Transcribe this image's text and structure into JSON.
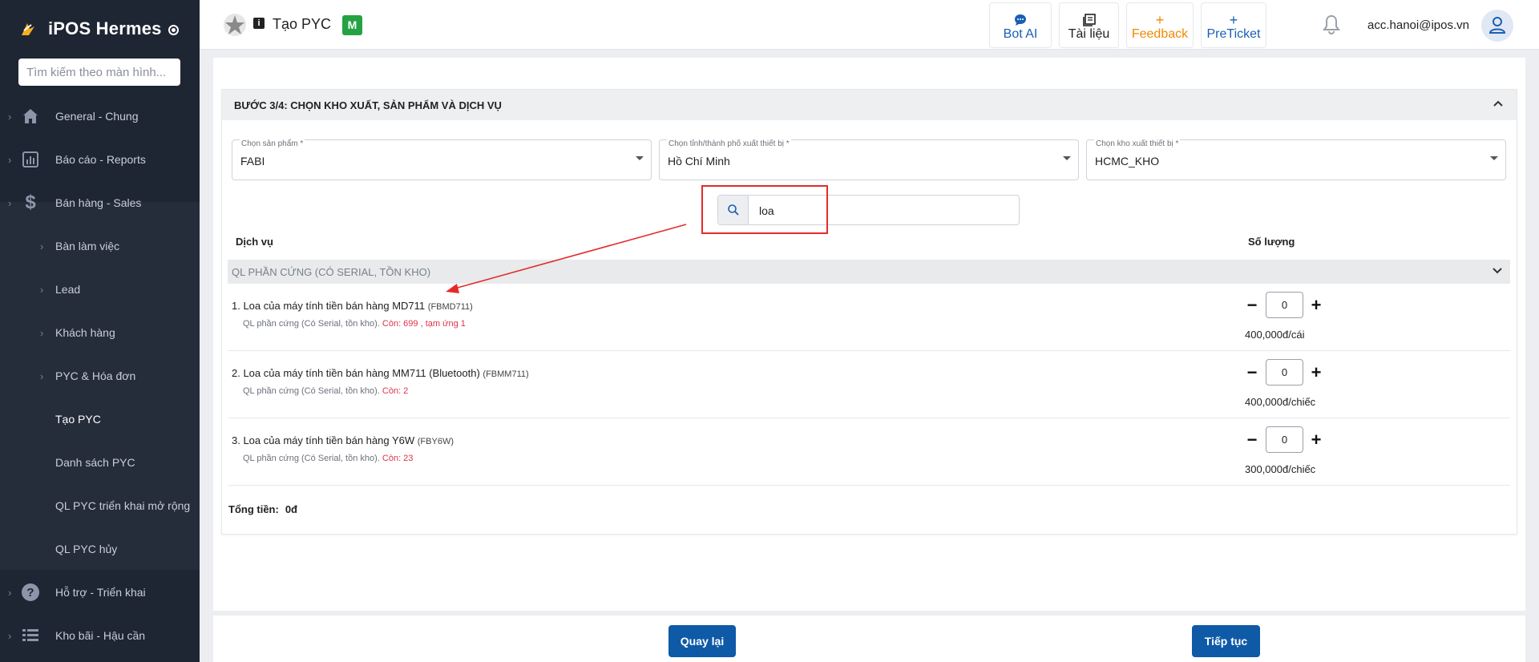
{
  "app": {
    "name": "iPOS Hermes",
    "search_placeholder": "Tìm kiếm theo màn hình..."
  },
  "sidebar": {
    "items": [
      {
        "label": "General - Chung",
        "icon": "home-icon"
      },
      {
        "label": "Báo cáo - Reports",
        "icon": "bar-chart-icon"
      },
      {
        "label": "Bán hàng - Sales",
        "icon": "dollar-icon"
      },
      {
        "label": "Bàn làm việc"
      },
      {
        "label": "Lead"
      },
      {
        "label": "Khách hàng"
      },
      {
        "label": "PYC & Hóa đơn"
      },
      {
        "label": "Tạo PYC"
      },
      {
        "label": "Danh sách PYC"
      },
      {
        "label": "QL PYC triển khai mở rộng"
      },
      {
        "label": "QL PYC hủy"
      },
      {
        "label": "Hỗ trợ - Triển khai",
        "icon": "help-circle-icon"
      },
      {
        "label": "Kho bãi - Hậu cần",
        "icon": "list-icon"
      }
    ]
  },
  "header": {
    "title": "Tạo PYC",
    "badge": "M",
    "buttons": [
      {
        "label": "Bot AI",
        "icon": "chat-icon",
        "color": "#1a5fb4"
      },
      {
        "label": "Tài liệu",
        "icon": "book-icon",
        "color": "#222222"
      },
      {
        "label": "Feedback",
        "icon": "plus-icon",
        "color": "#f08a00"
      },
      {
        "label": "PreTicket",
        "icon": "plus-icon",
        "color": "#1a5fb4"
      }
    ],
    "user_email": "acc.hanoi@ipos.vn"
  },
  "step": {
    "title": "BƯỚC 3/4: CHỌN KHO XUẤT, SẢN PHẨM VÀ DỊCH VỤ",
    "product": {
      "label": "Chọn sản phẩm *",
      "value": "FABI"
    },
    "province": {
      "label": "Chọn tỉnh/thành phố xuất thiết bị *",
      "value": "Hồ Chí Minh"
    },
    "warehouse": {
      "label": "Chọn kho xuất thiết bị *",
      "value": "HCMC_KHO"
    },
    "search_value": "loa",
    "col_service": "Dịch vụ",
    "col_qty": "Số lượng",
    "group": "QL PHẦN CỨNG (CÓ SERIAL, TỒN KHO)",
    "items": [
      {
        "name": "1. Loa của máy tính tiền bán hàng MD711",
        "code": "(FBMD711)",
        "sub": "QL phần cứng (Có Serial, tồn kho).",
        "stock": "Còn: 699 , tạm ứng 1",
        "qty": "0",
        "price": "400,000đ/cái"
      },
      {
        "name": "2. Loa của máy tính tiền bán hàng MM711 (Bluetooth)",
        "code": "(FBMM711)",
        "sub": "QL phần cứng (Có Serial, tồn kho).",
        "stock": "Còn: 2",
        "qty": "0",
        "price": "400,000đ/chiếc"
      },
      {
        "name": "3. Loa của máy tính tiền bán hàng Y6W",
        "code": "(FBY6W)",
        "sub": "QL phần cứng (Có Serial, tồn kho).",
        "stock": "Còn: 23",
        "qty": "0",
        "price": "300,000đ/chiếc"
      }
    ],
    "total_label": "Tổng tiền:",
    "total_value": "0đ"
  },
  "footer": {
    "back": "Quay lại",
    "next": "Tiếp tục"
  },
  "colors": {
    "sidebar": "#1e2533",
    "primary": "#0e5aa7",
    "highlight": "#e42b2b",
    "stock": "#e0314b"
  }
}
